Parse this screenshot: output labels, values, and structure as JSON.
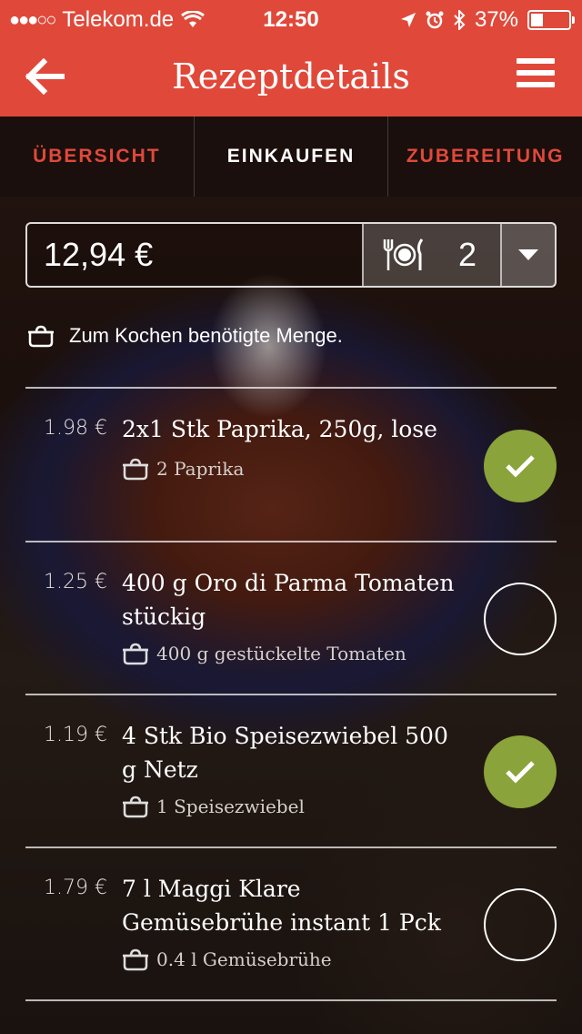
{
  "status": {
    "carrier": "Telekom.de",
    "time": "12:50",
    "battery": "37%",
    "battery_level": 0.37
  },
  "nav": {
    "title": "Rezeptdetails"
  },
  "tabs": [
    {
      "label": "ÜBERSICHT",
      "active": false
    },
    {
      "label": "EINKAUFEN",
      "active": true
    },
    {
      "label": "ZUBEREITUNG",
      "active": false
    }
  ],
  "controls": {
    "price": "12,94 €",
    "servings": "2"
  },
  "hint": "Zum Kochen benötigte Menge.",
  "items": [
    {
      "price": "1.98 €",
      "title": "2x1 Stk Paprika, 250g, lose",
      "need": "2  Paprika",
      "checked": true
    },
    {
      "price": "1.25 €",
      "title": "400 g Oro di Parma Tomaten stückig",
      "need": "400 g gestückelte Tomaten",
      "checked": false
    },
    {
      "price": "1.19 €",
      "title": "4 Stk Bio Speisezwiebel 500 g Netz",
      "need": "1  Speisezwiebel",
      "checked": true
    },
    {
      "price": "1.79 €",
      "title": "7 l Maggi Klare Gemüsebrühe instant 1 Pck",
      "need": "0.4 l Gemüsebrühe",
      "checked": false
    }
  ],
  "colors": {
    "accent": "#e0493a",
    "check_on": "#8aa33a"
  }
}
